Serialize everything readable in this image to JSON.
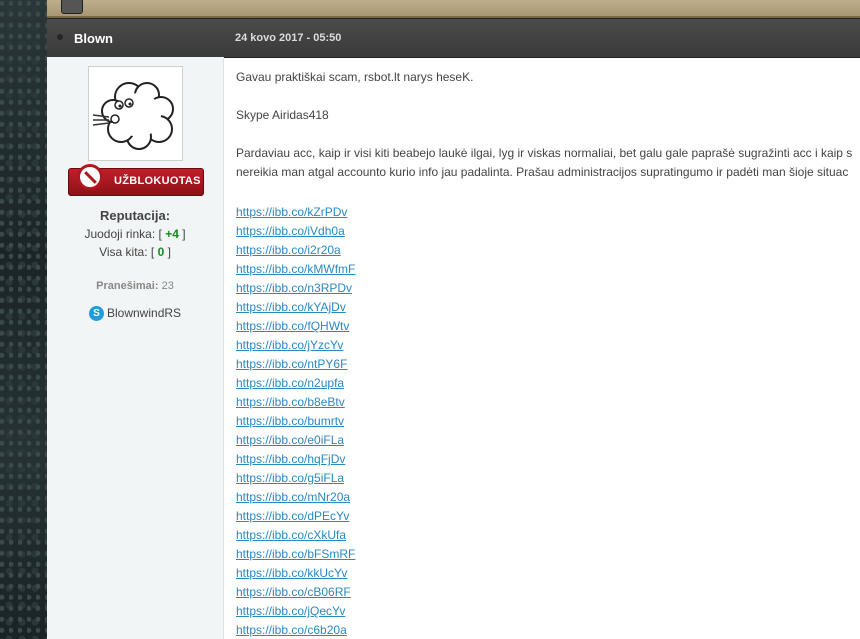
{
  "post": {
    "author": "Blown",
    "date": "24 kovo 2017 - 05:50"
  },
  "sidebar": {
    "banned_label": "UŽBLOKUOTAS",
    "reputation_title": "Reputacija:",
    "rep_black_market_label": "Juodoji rinka:",
    "rep_black_market_value": "+4",
    "rep_other_label": "Visa kita:",
    "rep_other_value": "0",
    "posts_label": "Pranešimai:",
    "posts_count": "23",
    "skype_name": "BlownwindRS",
    "skype_icon": "skype-icon"
  },
  "content": {
    "line1": "Gavau praktiškai scam, rsbot.lt narys heseK.",
    "line2": "Skype Airidas418",
    "line3": "Pardaviau acc, kaip ir visi kiti beabejo laukė ilgai, lyg ir viskas normaliai, bet galu gale paprašė sugražinti acc i kaip s",
    "line4": "nereikia man atgal accounto kurio info jau padalinta. Prašau administracijos supratingumo ir padėti man šioje situac",
    "links": [
      "https://ibb.co/kZrPDv",
      "https://ibb.co/iVdh0a",
      "https://ibb.co/i2r20a",
      "https://ibb.co/kMWfmF",
      "https://ibb.co/n3RPDv",
      "https://ibb.co/kYAjDv",
      "https://ibb.co/fQHWtv",
      "https://ibb.co/jYzcYv",
      "https://ibb.co/ntPY6F",
      "https://ibb.co/n2upfa",
      "https://ibb.co/b8eBtv",
      "https://ibb.co/bumrtv",
      "https://ibb.co/e0iFLa",
      "https://ibb.co/hqFjDv",
      "https://ibb.co/g5iFLa",
      "https://ibb.co/mNr20a",
      "https://ibb.co/dPEcYv",
      "https://ibb.co/cXkUfa",
      "https://ibb.co/bFSmRF",
      "https://ibb.co/kkUcYv",
      "https://ibb.co/cB06RF",
      "https://ibb.co/jQecYv",
      "https://ibb.co/c6b20a"
    ]
  }
}
